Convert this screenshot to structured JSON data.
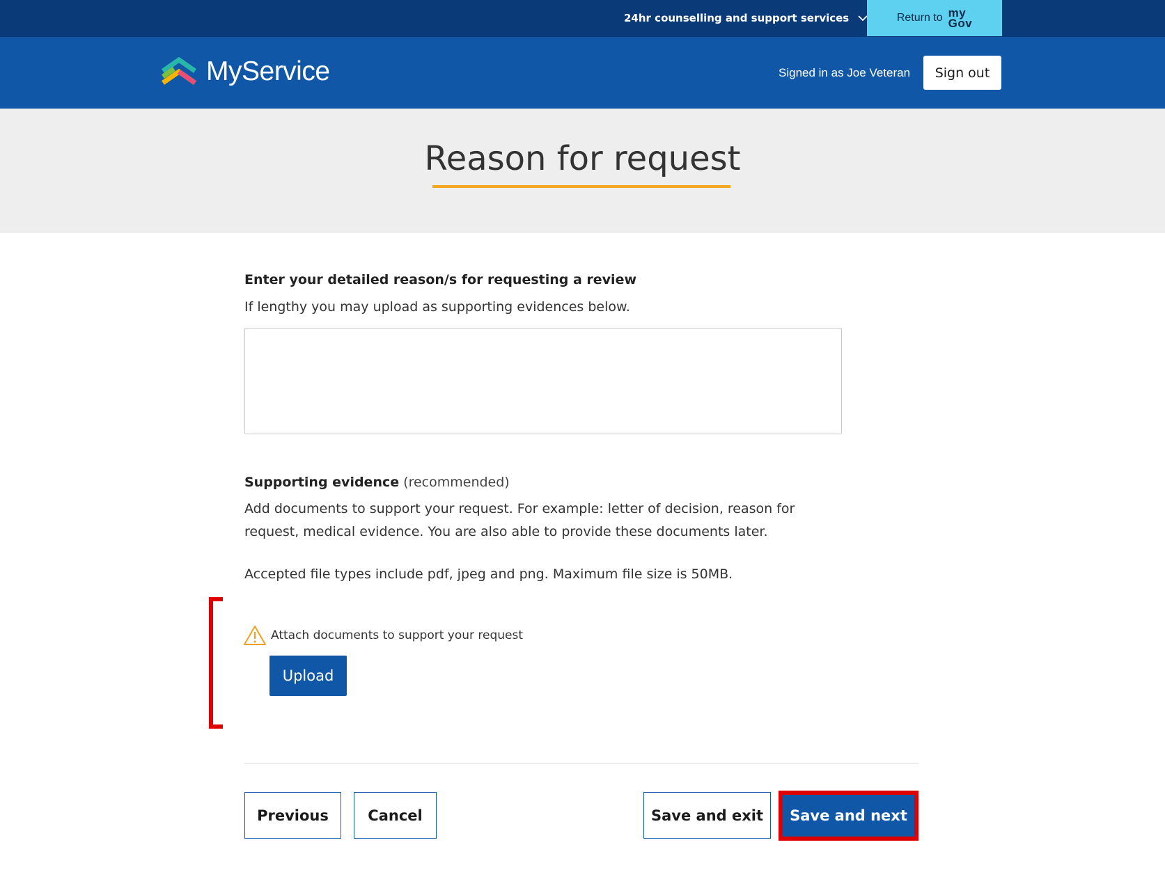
{
  "topbar": {
    "support_label": "24hr counselling and support services",
    "mygov": {
      "return_label": "Return to",
      "logo_top": "my",
      "logo_bottom": "Gov"
    }
  },
  "header": {
    "brand": "MyService",
    "signed_in": "Signed in as Joe Veteran",
    "sign_out": "Sign out"
  },
  "page": {
    "title": "Reason for request"
  },
  "form": {
    "reason_label": "Enter your detailed reason/s for requesting a review",
    "reason_hint": "If lengthy you may upload as supporting evidences below.",
    "reason_value": "",
    "evidence_heading": "Supporting evidence",
    "evidence_recommended": "(recommended)",
    "evidence_desc": "Add documents to support your request. For example: letter of decision, reason for request, medical evidence. You are also able to provide these documents later.",
    "accepted_types": "Accepted file types include pdf, jpeg and png. Maximum file size is 50MB.",
    "attach_warning": "Attach documents to support your request",
    "upload_label": "Upload"
  },
  "actions": {
    "previous": "Previous",
    "cancel": "Cancel",
    "save_exit": "Save and exit",
    "save_next": "Save and next"
  },
  "colors": {
    "topbar": "#0b3a78",
    "header": "#1157a8",
    "mygov_button": "#5fd1f0",
    "title_underline": "#f5a623",
    "highlight": "#e00000",
    "primary_button": "#1157a8"
  },
  "icons": [
    "chevron-down-icon",
    "myservice-logo-icon",
    "warning-icon"
  ]
}
